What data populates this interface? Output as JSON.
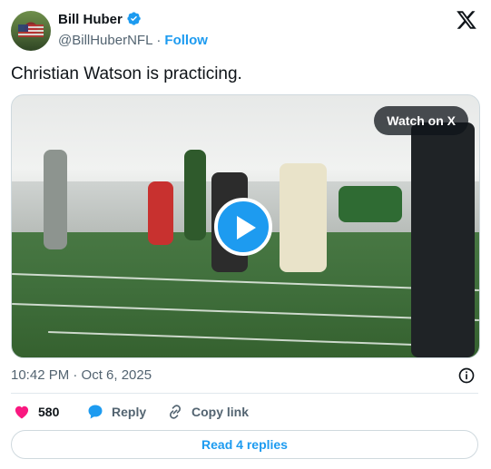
{
  "author": {
    "name": "Bill Huber",
    "handle": "@BillHuberNFL",
    "separator": "·",
    "follow_label": "Follow",
    "verified_icon": "verified-badge-icon",
    "verified_color": "#1d9bf0"
  },
  "platform_icon": "x-logo-icon",
  "tweet": {
    "text": "Christian Watson is practicing."
  },
  "media": {
    "watch_label": "Watch on X",
    "play_icon": "play-icon"
  },
  "timestamp": "10:42 PM · Oct 6, 2025",
  "actions": {
    "like_count": "580",
    "reply_label": "Reply",
    "copy_link_label": "Copy link"
  },
  "read_replies_label": "Read 4 replies",
  "colors": {
    "accent": "#1d9bf0",
    "like": "#f91880",
    "text": "#0f1419",
    "muted": "#536471"
  }
}
